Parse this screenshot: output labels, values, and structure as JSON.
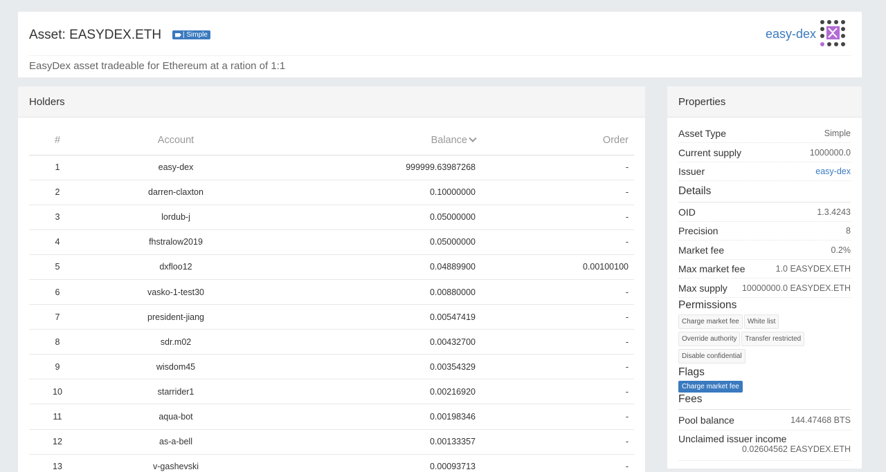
{
  "header": {
    "title_prefix": "Asset: ",
    "asset_symbol": "EASYDEX.ETH",
    "type_badge": "| Simple",
    "brand": "easy-dex",
    "description": "EasyDex asset tradeable for Ethereum at a ration of 1:1"
  },
  "holders": {
    "title": "Holders",
    "columns": {
      "num": "#",
      "account": "Account",
      "balance": "Balance",
      "order": "Order"
    },
    "rows": [
      {
        "num": "1",
        "account": "easy-dex",
        "balance": "999999.63987268",
        "order": "-"
      },
      {
        "num": "2",
        "account": "darren-claxton",
        "balance": "0.10000000",
        "order": "-"
      },
      {
        "num": "3",
        "account": "lordub-j",
        "balance": "0.05000000",
        "order": "-"
      },
      {
        "num": "4",
        "account": "fhstralow2019",
        "balance": "0.05000000",
        "order": "-"
      },
      {
        "num": "5",
        "account": "dxfloo12",
        "balance": "0.04889900",
        "order": "0.00100100"
      },
      {
        "num": "6",
        "account": "vasko-1-test30",
        "balance": "0.00880000",
        "order": "-"
      },
      {
        "num": "7",
        "account": "president-jiang",
        "balance": "0.00547419",
        "order": "-"
      },
      {
        "num": "8",
        "account": "sdr.m02",
        "balance": "0.00432700",
        "order": "-"
      },
      {
        "num": "9",
        "account": "wisdom45",
        "balance": "0.00354329",
        "order": "-"
      },
      {
        "num": "10",
        "account": "starrider1",
        "balance": "0.00216920",
        "order": "-"
      },
      {
        "num": "11",
        "account": "aqua-bot",
        "balance": "0.00198346",
        "order": "-"
      },
      {
        "num": "12",
        "account": "as-a-bell",
        "balance": "0.00133357",
        "order": "-"
      },
      {
        "num": "13",
        "account": "v-gashevski",
        "balance": "0.00093713",
        "order": "-"
      }
    ]
  },
  "properties": {
    "title": "Properties",
    "asset_type": {
      "label": "Asset Type",
      "value": "Simple"
    },
    "current_supply": {
      "label": "Current supply",
      "value": "1000000.0"
    },
    "issuer": {
      "label": "Issuer",
      "value": "easy-dex"
    },
    "details_title": "Details",
    "oid": {
      "label": "OID",
      "value": "1.3.4243"
    },
    "precision": {
      "label": "Precision",
      "value": "8"
    },
    "market_fee": {
      "label": "Market fee",
      "value": "0.2%"
    },
    "max_market_fee": {
      "label": "Max market fee",
      "value": "1.0 EASYDEX.ETH"
    },
    "max_supply": {
      "label": "Max supply",
      "value": "10000000.0 EASYDEX.ETH"
    },
    "permissions_title": "Permissions",
    "permissions": [
      "Charge market fee",
      "White list",
      "Override authority",
      "Transfer restricted",
      "Disable confidential"
    ],
    "flags_title": "Flags",
    "flags": [
      "Charge market fee"
    ],
    "fees_title": "Fees",
    "pool_balance": {
      "label": "Pool balance",
      "value": "144.47468 BTS"
    },
    "unclaimed": {
      "label": "Unclaimed issuer income",
      "value": "0.02604562 EASYDEX.ETH"
    }
  },
  "colors": {
    "link": "#3a7abf",
    "logo_purple": "#b36ad6",
    "logo_dark": "#444444"
  }
}
